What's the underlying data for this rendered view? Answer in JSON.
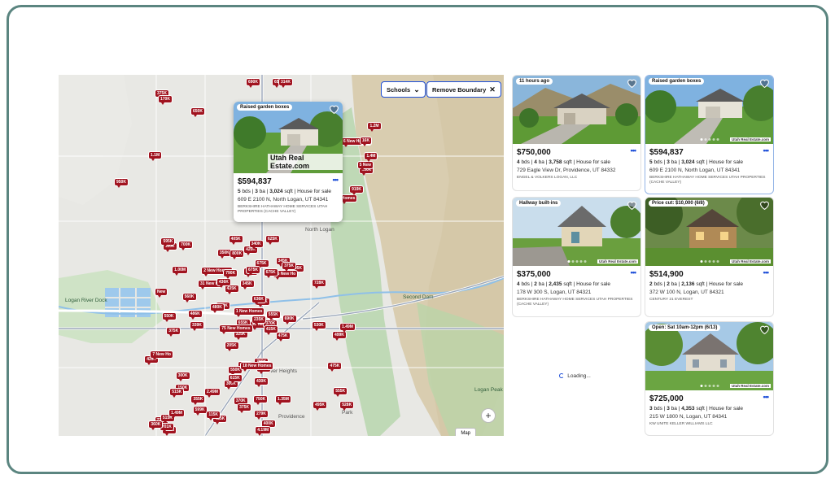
{
  "map": {
    "filters": {
      "schools_label": "Schools",
      "remove_boundary_label": "Remove Boundary"
    },
    "map_type_label": "Map",
    "zoom_in_label": "+",
    "places": [
      "Logan River Dock",
      "Second Dam",
      "Logan Peak",
      "North Logan",
      "River Heights",
      "Providence",
      "Logan",
      "Park"
    ],
    "pins": [
      "375K",
      "170K",
      "650K",
      "1.1M",
      "950K",
      "690K",
      "650K",
      "314K",
      "230K",
      "6 New Homes",
      "5 New",
      "Homes",
      "1.4M",
      "919K",
      "1.2M",
      "16K",
      "595K",
      "523K",
      "725K",
      "345K",
      "75 New Ho",
      "285K",
      "2 New Homes",
      "42 New Ho",
      "715K",
      "150K",
      "990K",
      "515K",
      "599K",
      "345K",
      "New",
      "425K",
      "339K",
      "520K",
      "550K",
      "400K",
      "325K",
      "370K",
      "655K",
      "31 New Ho",
      "675K",
      "528K",
      "495K",
      "205K",
      "480K",
      "486K",
      "430K",
      "625K",
      "370K",
      "219K",
      "375K",
      "415K",
      "515K",
      "435K",
      "300K",
      "475K",
      "355K",
      "700K",
      "595K",
      "750K",
      "375K",
      "New",
      "420K",
      "436K",
      "2.49M",
      "1.00M",
      "425K",
      "550K",
      "375K",
      "405K",
      "530K",
      "455K",
      "780K",
      "350K",
      "800K",
      "560K",
      "7 New Ho",
      "1 New Homes",
      "279K",
      "235K",
      "1.49M",
      "499K",
      "1.49M",
      "690K",
      "555K",
      "4.19M",
      "1.35M",
      "701K",
      "450K",
      "300K",
      "475K",
      "615K",
      "75 New Homes",
      "18 New Homes",
      "675K",
      "636K",
      "360K",
      "340K",
      "790K",
      "728K",
      "115K",
      "555K",
      "675K"
    ]
  },
  "popup": {
    "badge": "Raised garden boxes",
    "watermark": "Utah Real Estate.com",
    "price": "$594,837",
    "beds": "5",
    "baths": "3",
    "sqft": "3,024",
    "status": "House for sale",
    "address": "609 E 2100 N, North Logan, UT 84341",
    "broker": "BERKSHIRE HATHAWAY HOME SERVICES UTAH PROPERTIES (CACHE VALLEY)"
  },
  "listings": [
    {
      "badge": "11 hours ago",
      "price": "$750,000",
      "beds": "4",
      "baths": "4",
      "sqft": "3,758",
      "status": "House for sale",
      "address": "729 Eagle View Dr, Providence, UT 84332",
      "broker": "ENGEL & VOLKERS LOGAN, LLC"
    },
    {
      "badge": "Raised garden boxes",
      "watermark": "Utah Real Estate.com",
      "price": "$594,837",
      "beds": "5",
      "baths": "3",
      "sqft": "3,024",
      "status": "House for sale",
      "address": "609 E 2100 N, North Logan, UT 84341",
      "broker": "BERKSHIRE HATHAWAY HOME SERVICES UTAH PROPERTIES (CACHE VALLEY)"
    },
    {
      "badge": "Hallway built-ins",
      "watermark": "Utah Real Estate.com",
      "price": "$375,000",
      "beds": "4",
      "baths": "2",
      "sqft": "2,435",
      "status": "House for sale",
      "address": "178 W 300 S, Logan, UT 84321",
      "broker": "BERKSHIRE HATHAWAY HOME SERVICES UTAH PROPERTIES (CACHE VALLEY)"
    },
    {
      "badge": "Price cut: $10,000 (6/8)",
      "watermark": "Utah Real Estate.com",
      "price": "$514,900",
      "beds": "2",
      "baths": "2",
      "sqft": "2,136",
      "status": "House for sale",
      "address": "372 W 100 N, Logan, UT 84321",
      "broker": "CENTURY 21 EVEREST"
    },
    {
      "badge": "Open: Sat 10am-12pm (6/13)",
      "watermark": "Utah Real Estate.com",
      "price": "$725,000",
      "beds": "3",
      "baths": "3",
      "sqft": "4,353",
      "status": "House for sale",
      "address": "215 W 1800 N, Logan, UT 84341",
      "broker": "KW UNITE KELLER WILLIAMS LLC"
    }
  ],
  "loading_text": "Loading...",
  "units": {
    "bds": "bds",
    "ba": "ba",
    "sqft": "sqft",
    "more": "•••"
  }
}
